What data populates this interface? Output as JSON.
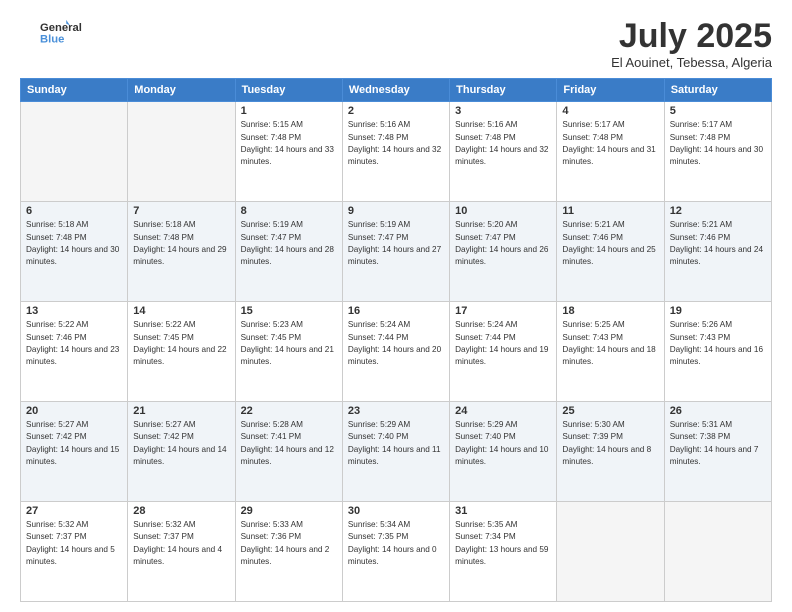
{
  "header": {
    "logo_line1": "General",
    "logo_line2": "Blue",
    "month_title": "July 2025",
    "location": "El Aouinet, Tebessa, Algeria"
  },
  "days_of_week": [
    "Sunday",
    "Monday",
    "Tuesday",
    "Wednesday",
    "Thursday",
    "Friday",
    "Saturday"
  ],
  "weeks": [
    [
      {
        "day": "",
        "empty": true
      },
      {
        "day": "",
        "empty": true
      },
      {
        "day": "1",
        "sunrise": "Sunrise: 5:15 AM",
        "sunset": "Sunset: 7:48 PM",
        "daylight": "Daylight: 14 hours and 33 minutes."
      },
      {
        "day": "2",
        "sunrise": "Sunrise: 5:16 AM",
        "sunset": "Sunset: 7:48 PM",
        "daylight": "Daylight: 14 hours and 32 minutes."
      },
      {
        "day": "3",
        "sunrise": "Sunrise: 5:16 AM",
        "sunset": "Sunset: 7:48 PM",
        "daylight": "Daylight: 14 hours and 32 minutes."
      },
      {
        "day": "4",
        "sunrise": "Sunrise: 5:17 AM",
        "sunset": "Sunset: 7:48 PM",
        "daylight": "Daylight: 14 hours and 31 minutes."
      },
      {
        "day": "5",
        "sunrise": "Sunrise: 5:17 AM",
        "sunset": "Sunset: 7:48 PM",
        "daylight": "Daylight: 14 hours and 30 minutes."
      }
    ],
    [
      {
        "day": "6",
        "sunrise": "Sunrise: 5:18 AM",
        "sunset": "Sunset: 7:48 PM",
        "daylight": "Daylight: 14 hours and 30 minutes."
      },
      {
        "day": "7",
        "sunrise": "Sunrise: 5:18 AM",
        "sunset": "Sunset: 7:48 PM",
        "daylight": "Daylight: 14 hours and 29 minutes."
      },
      {
        "day": "8",
        "sunrise": "Sunrise: 5:19 AM",
        "sunset": "Sunset: 7:47 PM",
        "daylight": "Daylight: 14 hours and 28 minutes."
      },
      {
        "day": "9",
        "sunrise": "Sunrise: 5:19 AM",
        "sunset": "Sunset: 7:47 PM",
        "daylight": "Daylight: 14 hours and 27 minutes."
      },
      {
        "day": "10",
        "sunrise": "Sunrise: 5:20 AM",
        "sunset": "Sunset: 7:47 PM",
        "daylight": "Daylight: 14 hours and 26 minutes."
      },
      {
        "day": "11",
        "sunrise": "Sunrise: 5:21 AM",
        "sunset": "Sunset: 7:46 PM",
        "daylight": "Daylight: 14 hours and 25 minutes."
      },
      {
        "day": "12",
        "sunrise": "Sunrise: 5:21 AM",
        "sunset": "Sunset: 7:46 PM",
        "daylight": "Daylight: 14 hours and 24 minutes."
      }
    ],
    [
      {
        "day": "13",
        "sunrise": "Sunrise: 5:22 AM",
        "sunset": "Sunset: 7:46 PM",
        "daylight": "Daylight: 14 hours and 23 minutes."
      },
      {
        "day": "14",
        "sunrise": "Sunrise: 5:22 AM",
        "sunset": "Sunset: 7:45 PM",
        "daylight": "Daylight: 14 hours and 22 minutes."
      },
      {
        "day": "15",
        "sunrise": "Sunrise: 5:23 AM",
        "sunset": "Sunset: 7:45 PM",
        "daylight": "Daylight: 14 hours and 21 minutes."
      },
      {
        "day": "16",
        "sunrise": "Sunrise: 5:24 AM",
        "sunset": "Sunset: 7:44 PM",
        "daylight": "Daylight: 14 hours and 20 minutes."
      },
      {
        "day": "17",
        "sunrise": "Sunrise: 5:24 AM",
        "sunset": "Sunset: 7:44 PM",
        "daylight": "Daylight: 14 hours and 19 minutes."
      },
      {
        "day": "18",
        "sunrise": "Sunrise: 5:25 AM",
        "sunset": "Sunset: 7:43 PM",
        "daylight": "Daylight: 14 hours and 18 minutes."
      },
      {
        "day": "19",
        "sunrise": "Sunrise: 5:26 AM",
        "sunset": "Sunset: 7:43 PM",
        "daylight": "Daylight: 14 hours and 16 minutes."
      }
    ],
    [
      {
        "day": "20",
        "sunrise": "Sunrise: 5:27 AM",
        "sunset": "Sunset: 7:42 PM",
        "daylight": "Daylight: 14 hours and 15 minutes."
      },
      {
        "day": "21",
        "sunrise": "Sunrise: 5:27 AM",
        "sunset": "Sunset: 7:42 PM",
        "daylight": "Daylight: 14 hours and 14 minutes."
      },
      {
        "day": "22",
        "sunrise": "Sunrise: 5:28 AM",
        "sunset": "Sunset: 7:41 PM",
        "daylight": "Daylight: 14 hours and 12 minutes."
      },
      {
        "day": "23",
        "sunrise": "Sunrise: 5:29 AM",
        "sunset": "Sunset: 7:40 PM",
        "daylight": "Daylight: 14 hours and 11 minutes."
      },
      {
        "day": "24",
        "sunrise": "Sunrise: 5:29 AM",
        "sunset": "Sunset: 7:40 PM",
        "daylight": "Daylight: 14 hours and 10 minutes."
      },
      {
        "day": "25",
        "sunrise": "Sunrise: 5:30 AM",
        "sunset": "Sunset: 7:39 PM",
        "daylight": "Daylight: 14 hours and 8 minutes."
      },
      {
        "day": "26",
        "sunrise": "Sunrise: 5:31 AM",
        "sunset": "Sunset: 7:38 PM",
        "daylight": "Daylight: 14 hours and 7 minutes."
      }
    ],
    [
      {
        "day": "27",
        "sunrise": "Sunrise: 5:32 AM",
        "sunset": "Sunset: 7:37 PM",
        "daylight": "Daylight: 14 hours and 5 minutes."
      },
      {
        "day": "28",
        "sunrise": "Sunrise: 5:32 AM",
        "sunset": "Sunset: 7:37 PM",
        "daylight": "Daylight: 14 hours and 4 minutes."
      },
      {
        "day": "29",
        "sunrise": "Sunrise: 5:33 AM",
        "sunset": "Sunset: 7:36 PM",
        "daylight": "Daylight: 14 hours and 2 minutes."
      },
      {
        "day": "30",
        "sunrise": "Sunrise: 5:34 AM",
        "sunset": "Sunset: 7:35 PM",
        "daylight": "Daylight: 14 hours and 0 minutes."
      },
      {
        "day": "31",
        "sunrise": "Sunrise: 5:35 AM",
        "sunset": "Sunset: 7:34 PM",
        "daylight": "Daylight: 13 hours and 59 minutes."
      },
      {
        "day": "",
        "empty": true
      },
      {
        "day": "",
        "empty": true
      }
    ]
  ]
}
